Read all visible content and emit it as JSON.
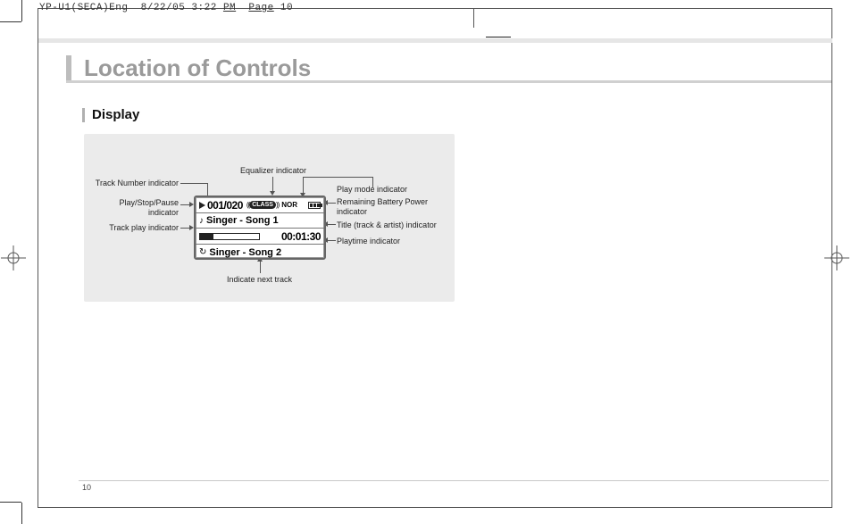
{
  "slug": {
    "file": "YP-U1(SECA)Eng",
    "date": "8/22/05 3:22",
    "ampm": "PM",
    "page_word": "Page",
    "page_no": "10"
  },
  "section_title": "Location of Controls",
  "sub_title": "Display",
  "page_number": "10",
  "lcd": {
    "track_counter": "001/020",
    "eq_label": "CLASS",
    "mode_label": "NOR",
    "title1": "Singer - Song 1",
    "playtime": "00:01:30",
    "title2": "Singer - Song 2"
  },
  "callouts": {
    "eq": "Equalizer indicator",
    "trackno": "Track Number indicator",
    "playstop": "Play/Stop/Pause\nindicator",
    "trackplay": "Track play indicator",
    "playmode": "Play mode indicator",
    "battery": "Remaining Battery Power\nindicator",
    "title": "Title (track & artist) indicator",
    "playtime": "Playtime indicator",
    "next": "Indicate next track"
  }
}
